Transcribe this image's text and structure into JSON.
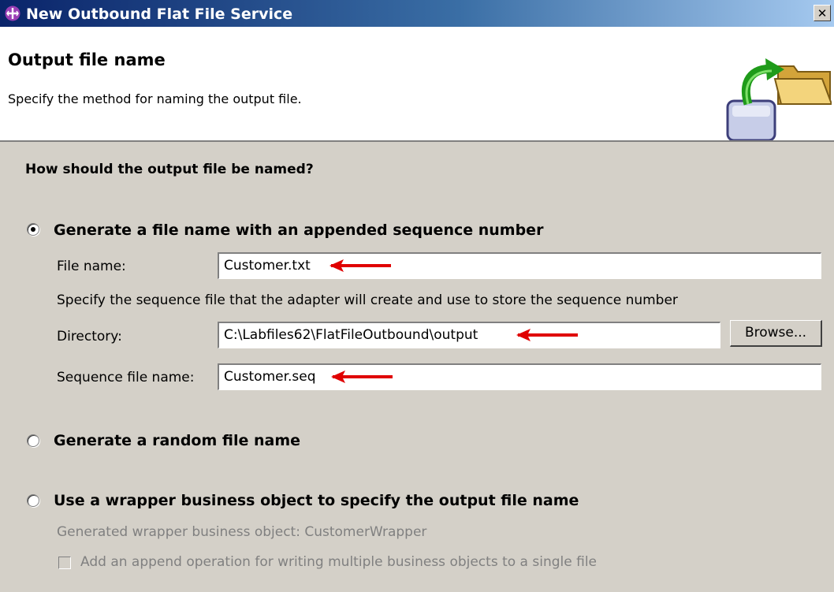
{
  "window": {
    "title": "New Outbound Flat File Service",
    "close_glyph": "✕"
  },
  "header": {
    "title": "Output file name",
    "description": "Specify the method for naming the output file.",
    "graphic_icon": "file-output-wizard-icon"
  },
  "main": {
    "question": "How should the output file be named?",
    "options": [
      {
        "label": "Generate a file name with an appended sequence number",
        "selected": true
      },
      {
        "label": "Generate a random file name",
        "selected": false
      },
      {
        "label": "Use a wrapper business object to specify the output file name",
        "selected": false
      }
    ],
    "sequence": {
      "file_name_label": "File name:",
      "file_name_value": "Customer.txt",
      "hint": "Specify the sequence file that the adapter will create and use to store the sequence number",
      "directory_label": "Directory:",
      "directory_value": "C:\\Labfiles62\\FlatFileOutbound\\output",
      "browse_label": "Browse...",
      "seq_file_label": "Sequence file name:",
      "seq_file_value": "Customer.seq"
    },
    "wrapper": {
      "generated_label": "Generated wrapper business object:",
      "generated_value": "CustomerWrapper",
      "append_label": "Add an append operation for writing multiple business objects to a single file",
      "append_checked": false
    }
  },
  "colors": {
    "annotation_arrow": "#e00000",
    "titlebar": "#0a246a"
  }
}
